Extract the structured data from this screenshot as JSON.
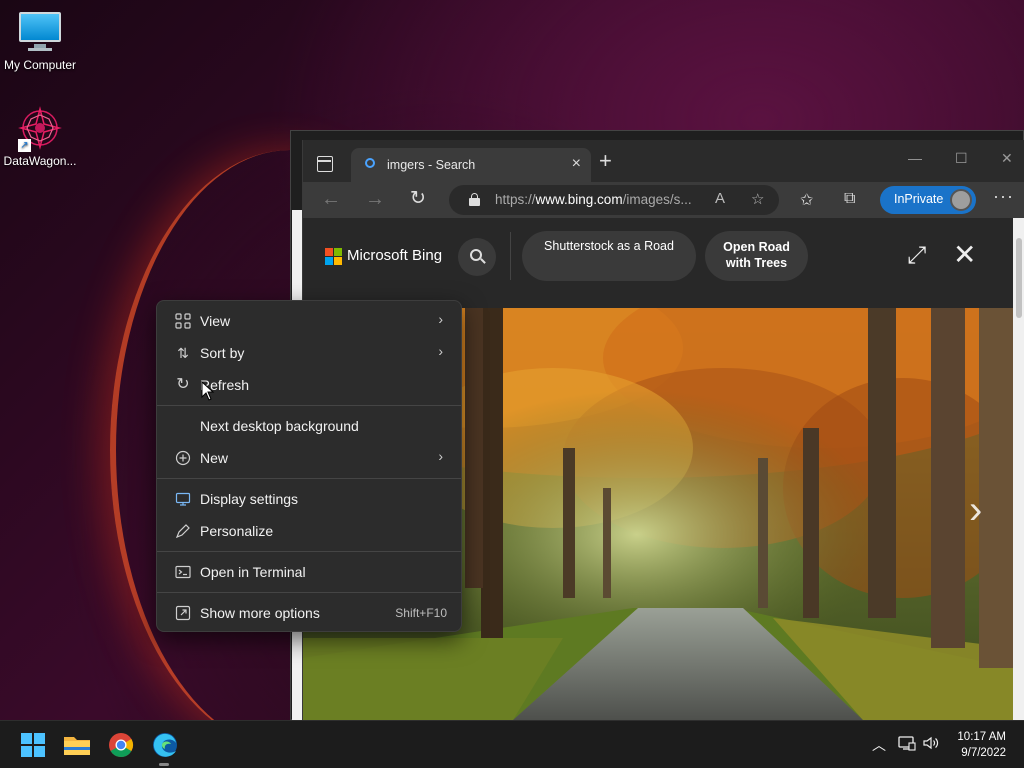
{
  "desktop": {
    "icons": [
      {
        "label": "My Computer"
      },
      {
        "label": "DataWagon..."
      }
    ]
  },
  "browser": {
    "tab": {
      "title": "imgers - Search"
    },
    "window_controls": {
      "minimize": "—",
      "maximize": "☐",
      "close": "✕"
    },
    "address_bar": {
      "url_prefix": "https://",
      "url_domain": "www.bing.com",
      "url_rest": "/images/s..."
    },
    "inprivate_label": "InPrivate",
    "bing": {
      "brand": "Microsoft Bing",
      "chips": [
        {
          "line1": "Shutterstock as a Road",
          "line2": ""
        },
        {
          "line1": "Open Road",
          "line2": "with Trees"
        }
      ]
    }
  },
  "context_menu": {
    "items": [
      {
        "label": "View",
        "icon": "grid-icon",
        "submenu": true
      },
      {
        "label": "Sort by",
        "icon": "sort-icon",
        "submenu": true
      },
      {
        "label": "Refresh",
        "icon": "refresh-icon",
        "submenu": false
      },
      {
        "label": "Next desktop background",
        "icon": "",
        "submenu": false
      },
      {
        "label": "New",
        "icon": "plus-circle-icon",
        "submenu": true
      },
      {
        "label": "Display settings",
        "icon": "display-icon",
        "submenu": false
      },
      {
        "label": "Personalize",
        "icon": "pen-icon",
        "submenu": false
      },
      {
        "label": "Open in Terminal",
        "icon": "terminal-icon",
        "submenu": false
      },
      {
        "label": "Show more options",
        "icon": "share-icon",
        "submenu": false,
        "shortcut": "Shift+F10"
      }
    ]
  },
  "taskbar": {
    "clock": {
      "time": "10:17 AM",
      "date": "9/7/2022"
    }
  },
  "colors": {
    "accent": "#1a73c9",
    "start": "#4cc2ff",
    "menu_bg": "#2c2c2c"
  }
}
